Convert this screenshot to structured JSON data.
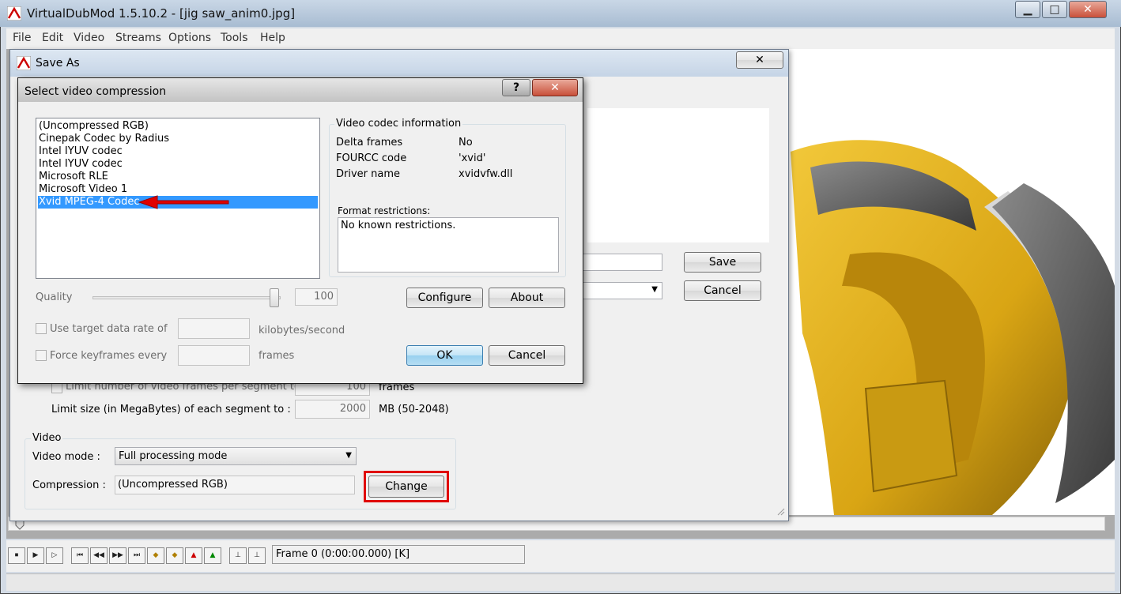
{
  "main": {
    "title": "VirtualDubMod 1.5.10.2 - [jig saw_anim0.jpg]",
    "minimize": "▁",
    "maximize": "□",
    "close": "✕",
    "menu": [
      "File",
      "Edit",
      "Video",
      "Streams",
      "Options",
      "Tools",
      "Help"
    ],
    "frame_status": "Frame 0 (0:00:00.000) [K]"
  },
  "save_as": {
    "title": "Save As",
    "close": "✕",
    "save_button": "Save",
    "cancel_button": "Cancel",
    "limit_frames_label": "Limit number of video frames per segment to",
    "limit_frames_value": "100",
    "limit_frames_unit": "frames",
    "limit_size_label": "Limit size (in MegaBytes) of each segment to :",
    "limit_size_value": "2000",
    "limit_size_unit": "MB (50-2048)",
    "video_group": "Video",
    "video_mode_label": "Video mode :",
    "video_mode_value": "Full processing mode",
    "compression_label": "Compression :",
    "compression_value": "(Uncompressed RGB)",
    "change_button": "Change"
  },
  "codec_dialog": {
    "title": "Select video compression",
    "help": "?",
    "close": "✕",
    "codecs": [
      "(Uncompressed RGB)",
      "Cinepak Codec by Radius",
      "Intel IYUV codec",
      "Intel IYUV codec",
      "Microsoft RLE",
      "Microsoft Video 1",
      "Xvid MPEG-4 Codec"
    ],
    "selected_index": 6,
    "info_group": "Video codec information",
    "info": [
      {
        "key": "Delta frames",
        "value": "No"
      },
      {
        "key": "FOURCC code",
        "value": "'xvid'"
      },
      {
        "key": "Driver name",
        "value": "xvidvfw.dll"
      }
    ],
    "restrictions_label": "Format restrictions:",
    "restrictions_value": "No known restrictions.",
    "quality_label": "Quality",
    "quality_value": "100",
    "quality_level": 1.0,
    "configure_button": "Configure",
    "about_button": "About",
    "target_rate_label": "Use target data rate of",
    "target_rate_unit": "kilobytes/second",
    "keyframes_label": "Force keyframes every",
    "keyframes_unit": "frames",
    "ok_button": "OK",
    "cancel_button": "Cancel"
  },
  "colors": {
    "selection": "#3399ff",
    "highlight_box": "#e00000",
    "arrow": "#e00000",
    "model_yellow": "#d9a514",
    "model_gray": "#5a5a5a"
  }
}
